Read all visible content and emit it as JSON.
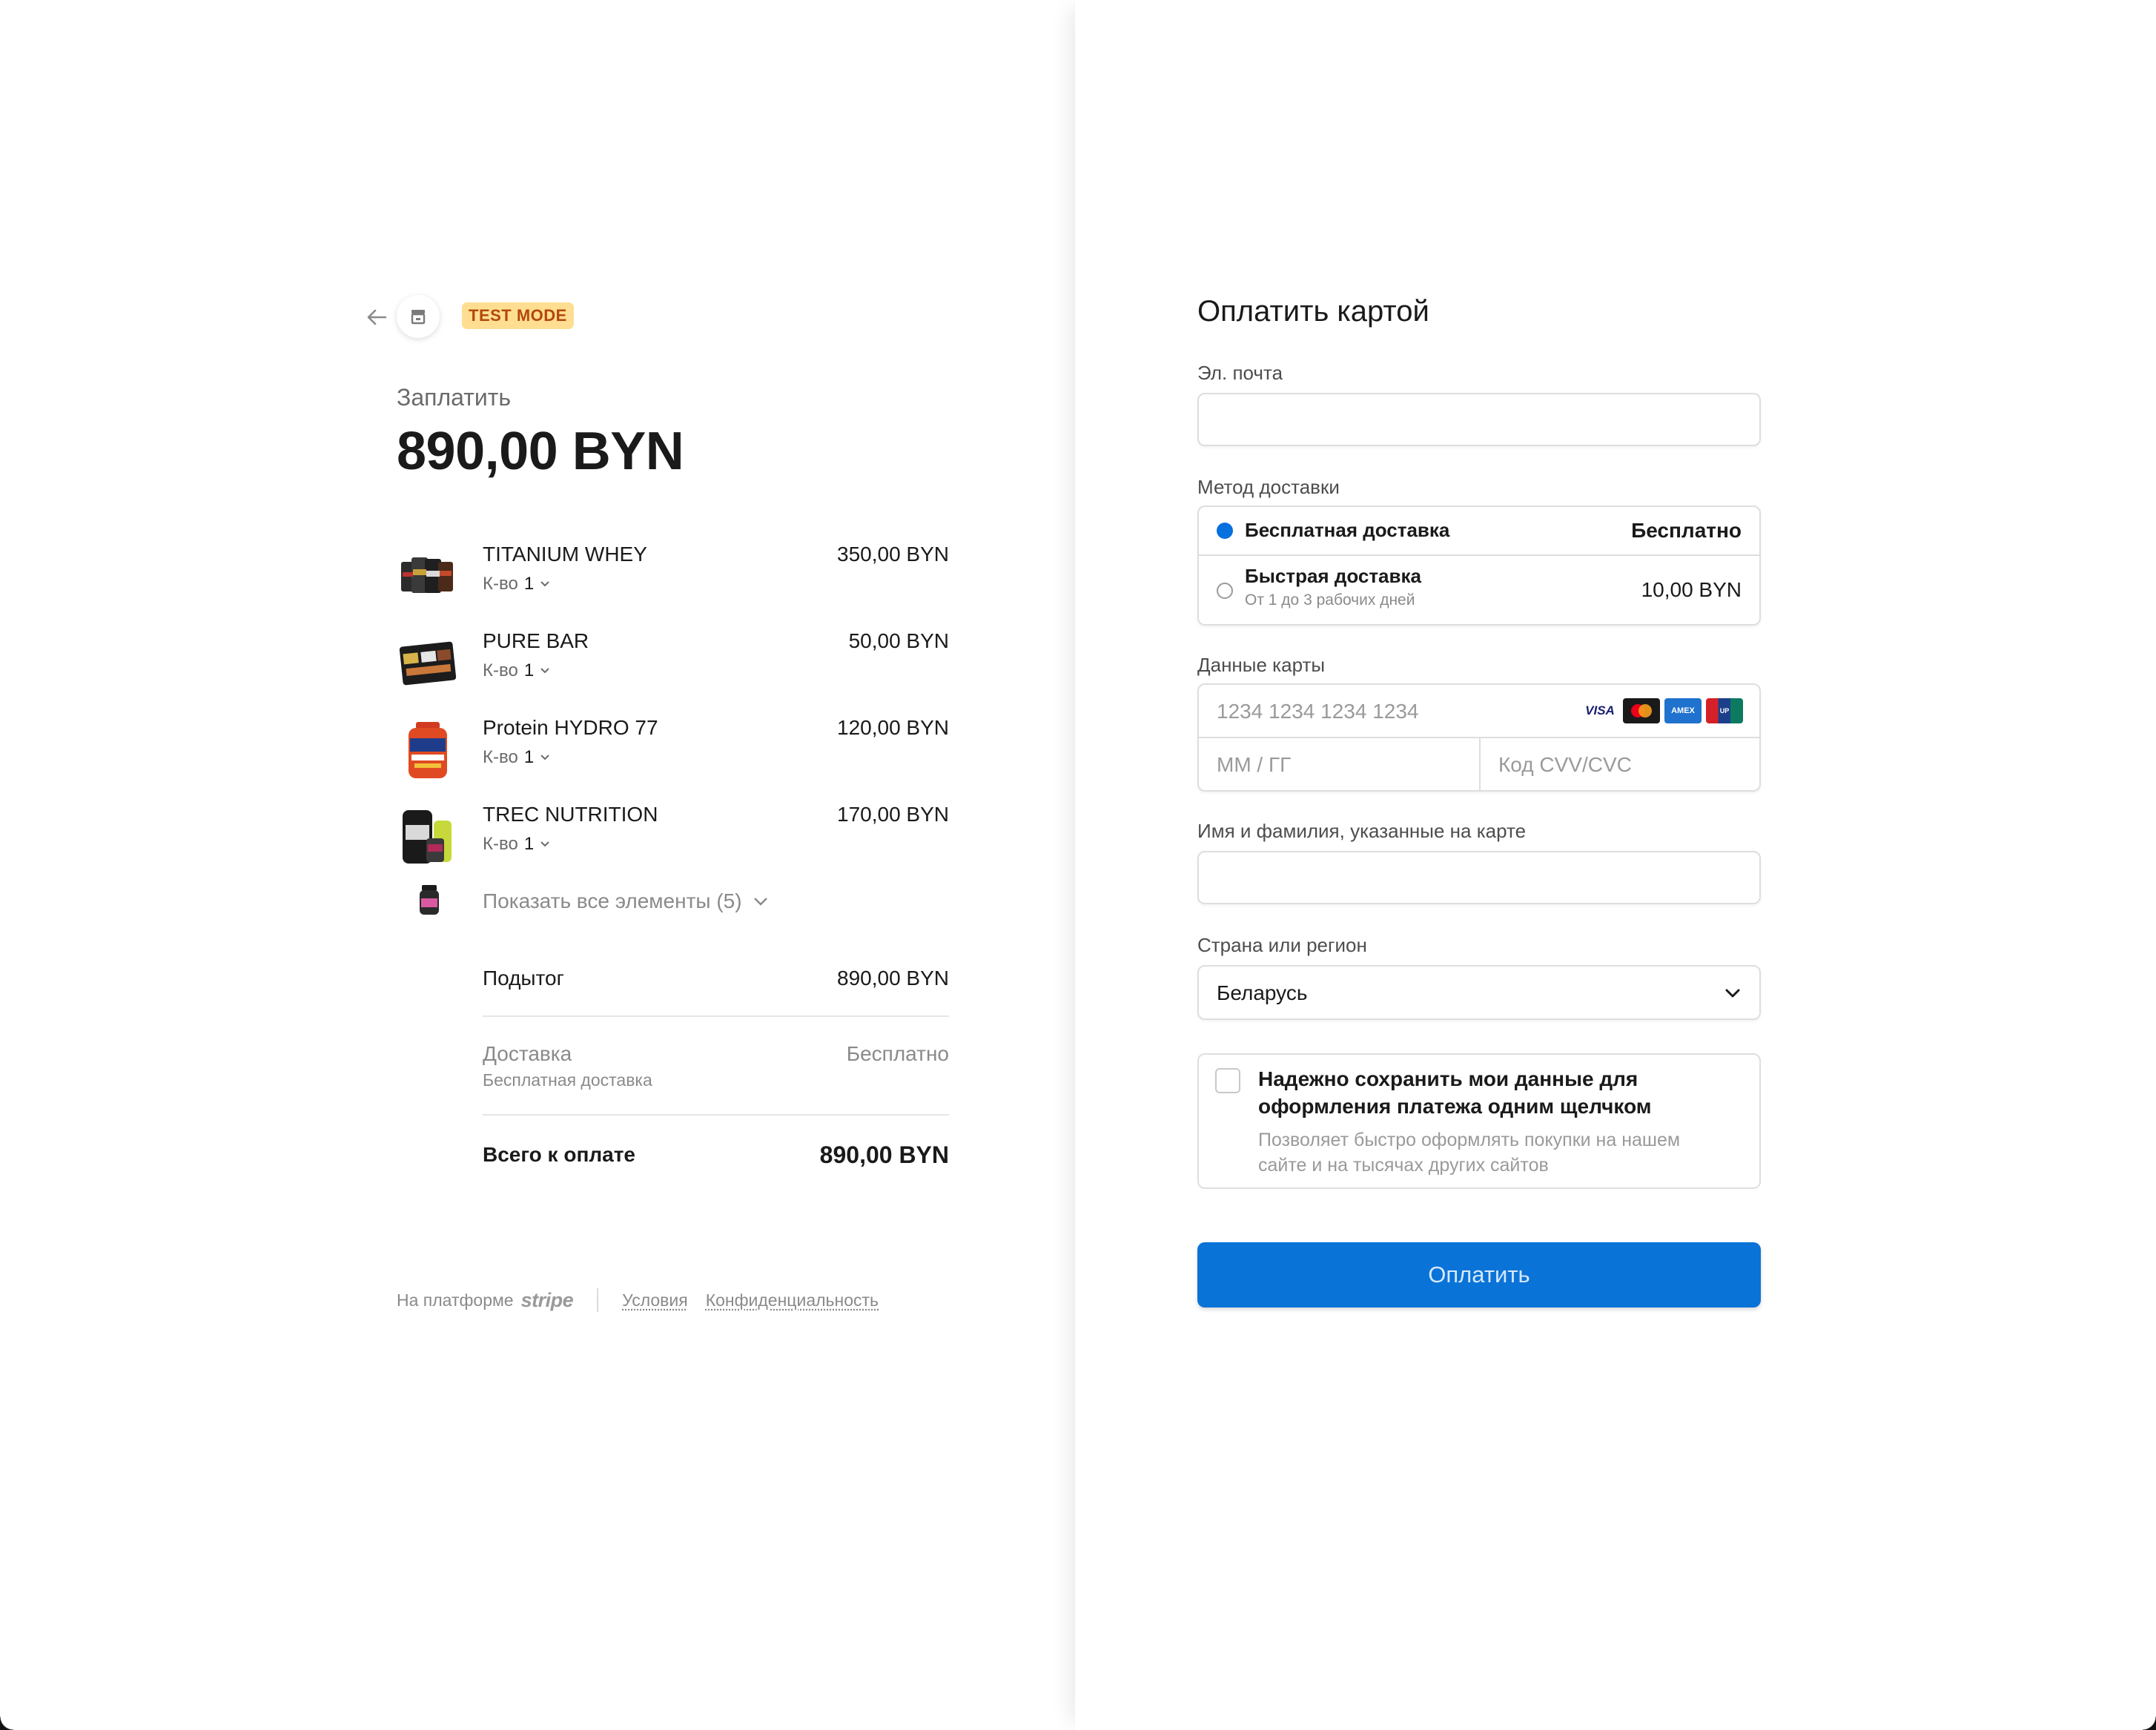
{
  "header": {
    "test_badge": "TEST MODE"
  },
  "summary": {
    "pay_label": "Заплатить",
    "amount": "890,00 BYN",
    "qty_label": "К-во",
    "items": [
      {
        "name": "TITANIUM WHEY",
        "price": "350,00 BYN",
        "qty": "1"
      },
      {
        "name": "PURE BAR",
        "price": "50,00 BYN",
        "qty": "1"
      },
      {
        "name": "Protein HYDRO 77",
        "price": "120,00 BYN",
        "qty": "1"
      },
      {
        "name": "TREC NUTRITION",
        "price": "170,00 BYN",
        "qty": "1"
      }
    ],
    "show_all": "Показать все элементы (5)",
    "subtotal_label": "Подытог",
    "subtotal_value": "890,00 BYN",
    "shipping_label": "Доставка",
    "shipping_sub": "Бесплатная доставка",
    "shipping_value": "Бесплатно",
    "total_label": "Всего к оплате",
    "total_value": "890,00 BYN"
  },
  "footer": {
    "powered_by": "На платформе",
    "brand": "stripe",
    "terms": "Условия",
    "privacy": "Конфиденциальность"
  },
  "form": {
    "title": "Оплатить картой",
    "email_label": "Эл. почта",
    "email_value": "",
    "shipping_method_label": "Метод доставки",
    "shipping_options": [
      {
        "title": "Бесплатная доставка",
        "subtitle": "",
        "price": "Бесплатно",
        "selected": true
      },
      {
        "title": "Быстрая доставка",
        "subtitle": "От 1 до 3 рабочих дней",
        "price": "10,00 BYN",
        "selected": false
      }
    ],
    "card_label": "Данные карты",
    "card_number_placeholder": "1234 1234 1234 1234",
    "card_brands": [
      "VISA",
      "Mastercard",
      "American Express",
      "UnionPay"
    ],
    "expiry_placeholder": "ММ / ГГ",
    "cvc_placeholder": "Код CVV/CVC",
    "name_label": "Имя и фамилия, указанные на карте",
    "name_value": "",
    "country_label": "Страна или регион",
    "country_value": "Беларусь",
    "save_title": "Надежно сохранить мои данные для оформления платежа одним щелчком",
    "save_desc": "Позволяет быстро оформлять покупки на нашем сайте и на тысячах других сайтов",
    "save_checked": false,
    "pay_button": "Оплатить"
  },
  "colors": {
    "accent": "#0a73d8",
    "radio_selected": "#0570de",
    "test_badge_bg": "#ffde92",
    "test_badge_text": "#b3480b"
  }
}
